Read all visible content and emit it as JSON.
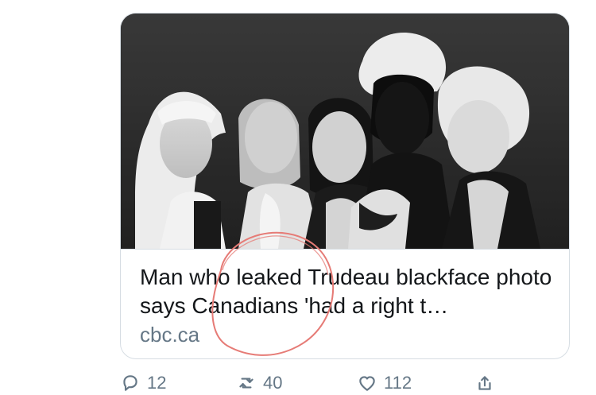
{
  "card": {
    "title": "Man who leaked Trudeau blackface photo says Canadians 'had a right t…",
    "domain": "cbc.ca"
  },
  "actions": {
    "reply_count": "12",
    "retweet_count": "40",
    "like_count": "112"
  },
  "icons": {
    "reply": "reply-icon",
    "retweet": "retweet-icon",
    "like": "heart-icon",
    "share": "share-icon"
  },
  "colors": {
    "title": "#14171a",
    "secondary": "#657786",
    "border": "#d6dde3",
    "annotation": "#e67b76"
  }
}
